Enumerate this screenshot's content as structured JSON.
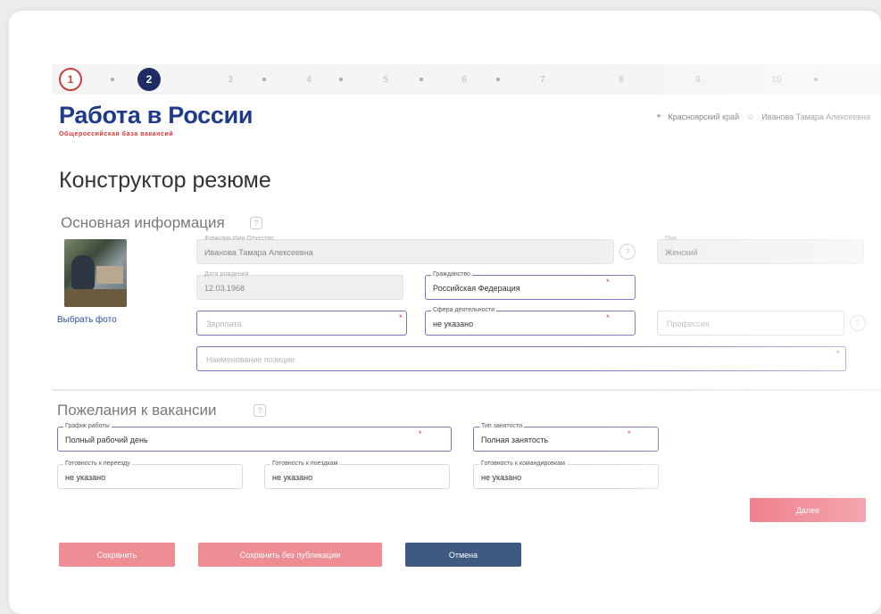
{
  "stepper": {
    "steps": [
      "1",
      "2",
      "3",
      "4",
      "5",
      "6",
      "7",
      "8",
      "9",
      "10"
    ]
  },
  "header": {
    "logo_title": "Работа в России",
    "logo_subtitle": "Общероссийская база вакансий",
    "region": "Красноярский край",
    "user_name": "Иванова Тамара Алексеевна"
  },
  "page_title": "Конструктор резюме",
  "basic_info": {
    "title": "Основная информация",
    "choose_photo": "Выбрать фото",
    "full_name": {
      "label": "Фамилия Имя Отчество",
      "value": "Иванова Тамара Алексеевна"
    },
    "gender": {
      "label": "Пол",
      "value": "Женский"
    },
    "birth_date": {
      "label": "Дата рождения",
      "value": "12.03.1968"
    },
    "citizenship": {
      "label": "Гражданство",
      "value": "Российская Федерация"
    },
    "salary": {
      "placeholder": "Зарплата"
    },
    "field_of_activity": {
      "label": "Сфера деятельности",
      "value": "не указано"
    },
    "profession": {
      "placeholder": "Профессия"
    },
    "position": {
      "placeholder": "Наименование позиции"
    }
  },
  "wishes": {
    "title": "Пожелания к вакансии",
    "schedule": {
      "label": "График работы",
      "value": "Полный рабочий день"
    },
    "employment_type": {
      "label": "Тип занятости",
      "value": "Полная занятость"
    },
    "ready_to_move": {
      "label": "Готовность к переезду",
      "value": "не указано"
    },
    "ready_for_trips": {
      "label": "Готовность к поездкам",
      "value": "не указано"
    },
    "ready_for_business_trips": {
      "label": "Готовность к командировкам",
      "value": "не указано"
    }
  },
  "buttons": {
    "next": "Далее",
    "save": "Сохранить",
    "save_no_publish": "Сохранить без публикации",
    "cancel": "Отмена"
  },
  "colors": {
    "brand_blue": "#1f3a8a",
    "active_step": "#1f2b63",
    "accent_red": "#e84c5c",
    "field_highlight": "#7b74b6",
    "cancel_blue": "#3e5a80"
  }
}
